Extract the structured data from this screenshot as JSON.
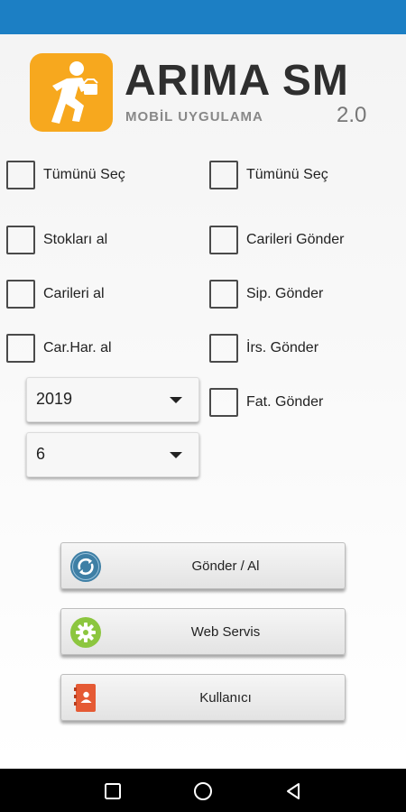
{
  "logo": {
    "title": "ARIMA SM",
    "subtitle": "MOBİL UYGULAMA",
    "version": "2.0"
  },
  "left_column": {
    "select_all": "Tümünü Seç",
    "items": [
      "Stokları al",
      "Carileri al",
      "Car.Har. al"
    ]
  },
  "right_column": {
    "select_all": "Tümünü Seç",
    "items": [
      "Carileri Gönder",
      "Sip. Gönder",
      "İrs. Gönder",
      "Fat. Gönder"
    ]
  },
  "year_spinner": {
    "value": "2019"
  },
  "month_spinner": {
    "value": "6"
  },
  "buttons": {
    "send_receive": "Gönder / Al",
    "web_service": "Web Servis",
    "user": "Kullanıcı"
  },
  "icons": {
    "logo": "running-man-icon",
    "send_receive": "sync-icon",
    "web_service": "gear-icon",
    "user": "contact-book-icon",
    "nav_recents": "square-icon",
    "nav_home": "circle-icon",
    "nav_back": "back-triangle-icon"
  },
  "colors": {
    "status_bar": "#1c7fc4",
    "logo_orange": "#f7a81e",
    "sync_blue": "#3e7fa5",
    "gear_green": "#8cc63f",
    "contact_red": "#e55a34"
  }
}
